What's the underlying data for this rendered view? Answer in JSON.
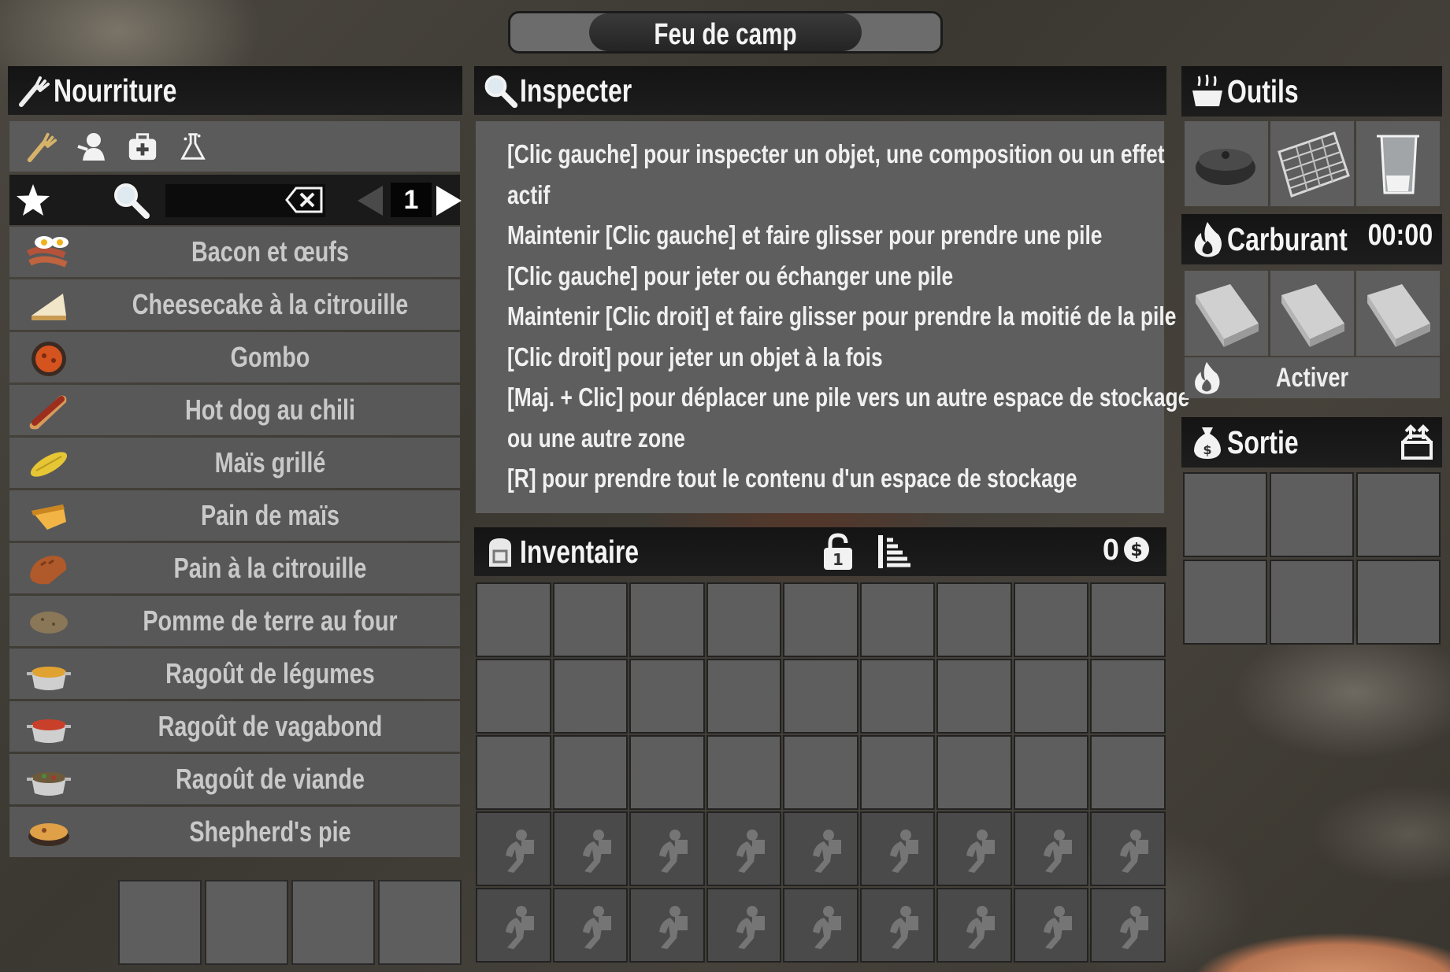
{
  "window": {
    "title": "Feu de camp"
  },
  "food": {
    "header": "Nourriture",
    "tabs": [
      "fork-icon",
      "cook-icon",
      "medical-icon",
      "chemistry-icon"
    ],
    "search": {
      "placeholder": "",
      "value": ""
    },
    "page": "1",
    "recipes": [
      {
        "name": "Bacon et œufs",
        "icon": "bacon-eggs-icon"
      },
      {
        "name": "Cheesecake à la citrouille",
        "icon": "pie-slice-icon"
      },
      {
        "name": "Gombo",
        "icon": "gumbo-bowl-icon"
      },
      {
        "name": "Hot dog au chili",
        "icon": "hot-dog-icon"
      },
      {
        "name": "Maïs grillé",
        "icon": "corn-icon"
      },
      {
        "name": "Pain de maïs",
        "icon": "cornbread-icon"
      },
      {
        "name": "Pain à la citrouille",
        "icon": "bread-loaf-icon"
      },
      {
        "name": "Pomme de terre au four",
        "icon": "potato-icon"
      },
      {
        "name": "Ragoût de légumes",
        "icon": "stew-pot-icon"
      },
      {
        "name": "Ragoût de vagabond",
        "icon": "stew-pot-icon"
      },
      {
        "name": "Ragoût de viande",
        "icon": "stew-pot-icon"
      },
      {
        "name": "Shepherd's pie",
        "icon": "pie-dish-icon"
      }
    ]
  },
  "inspect": {
    "header": "Inspecter",
    "lines": [
      "[Clic gauche] pour inspecter un objet, une composition ou un effet",
      "actif",
      "Maintenir [Clic gauche] et faire glisser pour prendre une pile",
      "[Clic gauche] pour jeter ou échanger une pile",
      "Maintenir [Clic droit] et faire glisser pour prendre la moitié de la pile",
      "[Clic droit] pour jeter un objet à la fois",
      "[Maj. + Clic] pour déplacer une pile vers un autre espace de stockage",
      "ou une autre zone",
      "[R] pour prendre tout le contenu d'un espace de stockage"
    ]
  },
  "inventory": {
    "header": "Inventaire",
    "money": "0"
  },
  "tools": {
    "header": "Outils",
    "slots": [
      "cooking-pot-icon",
      "grill-icon",
      "beaker-icon"
    ]
  },
  "fuel": {
    "header": "Carburant",
    "timer": "00:00",
    "slots": [
      "wood-icon",
      "wood-icon",
      "wood-icon"
    ],
    "activate_label": "Activer"
  },
  "output": {
    "header": "Sortie"
  },
  "colors": {
    "panel": "#5e5e5e",
    "header": "#171717",
    "text": "#f4f4f4",
    "recipe_text": "#c9c9c9"
  }
}
